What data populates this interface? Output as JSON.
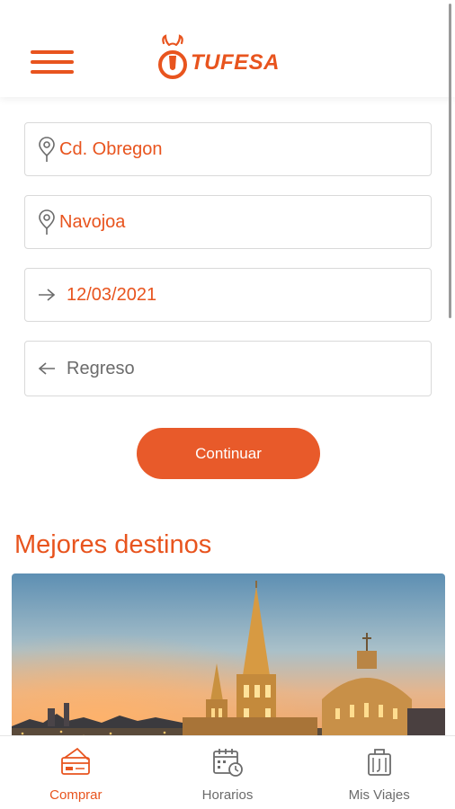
{
  "header": {
    "menu_icon": "hamburger-menu-icon",
    "logo_text": "TUFESA",
    "accent_color": "#e8541e"
  },
  "search_form": {
    "origin": {
      "icon": "map-pin-icon",
      "value": "Cd. Obregon"
    },
    "destination": {
      "icon": "map-pin-icon",
      "value": "Navojoa"
    },
    "departure_date": {
      "icon": "arrow-right-icon",
      "value": "12/03/2021"
    },
    "return_date": {
      "icon": "arrow-left-icon",
      "placeholder": "Regreso"
    },
    "submit_label": "Continuar"
  },
  "destinations": {
    "title": "Mejores destinos"
  },
  "bottom_nav": {
    "items": [
      {
        "label": "Comprar",
        "icon": "ticket-purchase-icon",
        "active": true
      },
      {
        "label": "Horarios",
        "icon": "calendar-clock-icon",
        "active": false
      },
      {
        "label": "Mis Viajes",
        "icon": "luggage-icon",
        "active": false
      }
    ]
  }
}
